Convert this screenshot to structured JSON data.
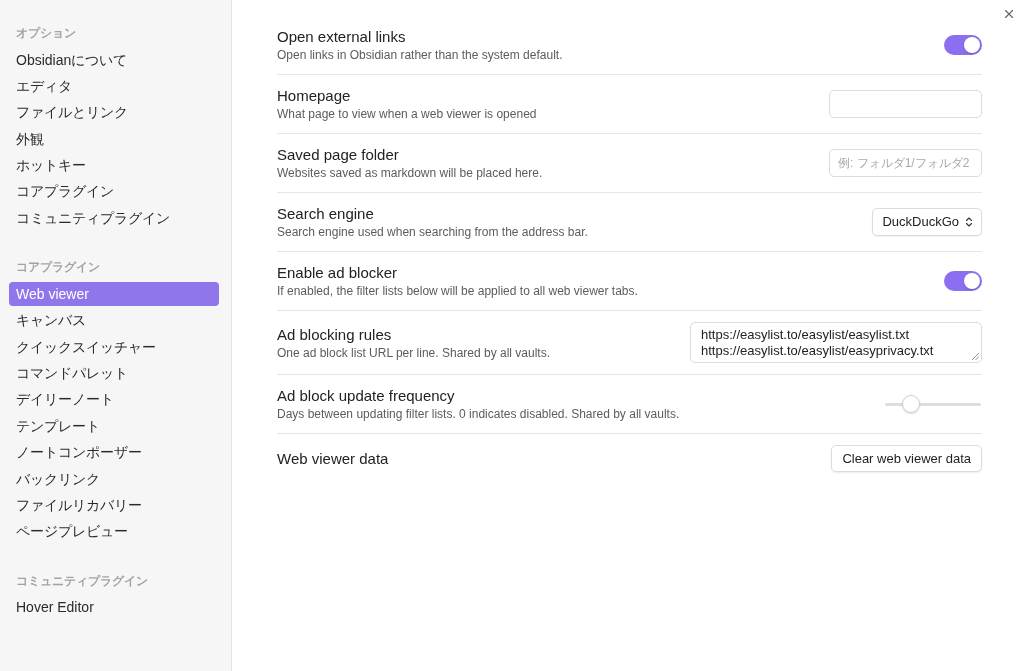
{
  "sidebar": {
    "sections": [
      {
        "heading": "オプション",
        "items": [
          {
            "label": "Obsidianについて",
            "selected": false
          },
          {
            "label": "エディタ",
            "selected": false
          },
          {
            "label": "ファイルとリンク",
            "selected": false
          },
          {
            "label": "外観",
            "selected": false
          },
          {
            "label": "ホットキー",
            "selected": false
          },
          {
            "label": "コアプラグイン",
            "selected": false
          },
          {
            "label": "コミュニティプラグイン",
            "selected": false
          }
        ]
      },
      {
        "heading": "コアプラグイン",
        "items": [
          {
            "label": "Web viewer",
            "selected": true
          },
          {
            "label": "キャンバス",
            "selected": false
          },
          {
            "label": "クイックスイッチャー",
            "selected": false
          },
          {
            "label": "コマンドパレット",
            "selected": false
          },
          {
            "label": "デイリーノート",
            "selected": false
          },
          {
            "label": "テンプレート",
            "selected": false
          },
          {
            "label": "ノートコンポーザー",
            "selected": false
          },
          {
            "label": "バックリンク",
            "selected": false
          },
          {
            "label": "ファイルリカバリー",
            "selected": false
          },
          {
            "label": "ページプレビュー",
            "selected": false
          }
        ]
      },
      {
        "heading": "コミュニティプラグイン",
        "items": [
          {
            "label": "Hover Editor",
            "selected": false
          }
        ]
      }
    ]
  },
  "settings": [
    {
      "kind": "toggle",
      "title": "Open external links",
      "description": "Open links in Obsidian rather than the system default.",
      "on": true
    },
    {
      "kind": "text",
      "title": "Homepage",
      "description": "What page to view when a web viewer is opened"
    },
    {
      "kind": "text",
      "title": "Saved page folder",
      "description": "Websites saved as markdown will be placed here.",
      "placeholder": "例: フォルダ1/フォルダ2"
    },
    {
      "kind": "dropdown",
      "title": "Search engine",
      "description": "Search engine used when searching from the address bar.",
      "value": "DuckDuckGo"
    },
    {
      "kind": "toggle",
      "title": "Enable ad blocker",
      "description": "If enabled, the filter lists below will be applied to all web viewer tabs.",
      "on": true
    },
    {
      "kind": "textarea",
      "title": "Ad blocking rules",
      "description": "One ad block list URL per line. Shared by all vaults.",
      "lines": [
        "https://easylist.to/easylist/easylist.txt",
        "https://easylist.to/easylist/easyprivacy.txt"
      ]
    },
    {
      "kind": "slider",
      "title": "Ad block update frequency",
      "description": "Days between updating filter lists. 0 indicates disabled. Shared by all vaults.",
      "level": 0.22
    },
    {
      "kind": "button",
      "title": "Web viewer data",
      "button": "Clear web viewer data"
    }
  ]
}
